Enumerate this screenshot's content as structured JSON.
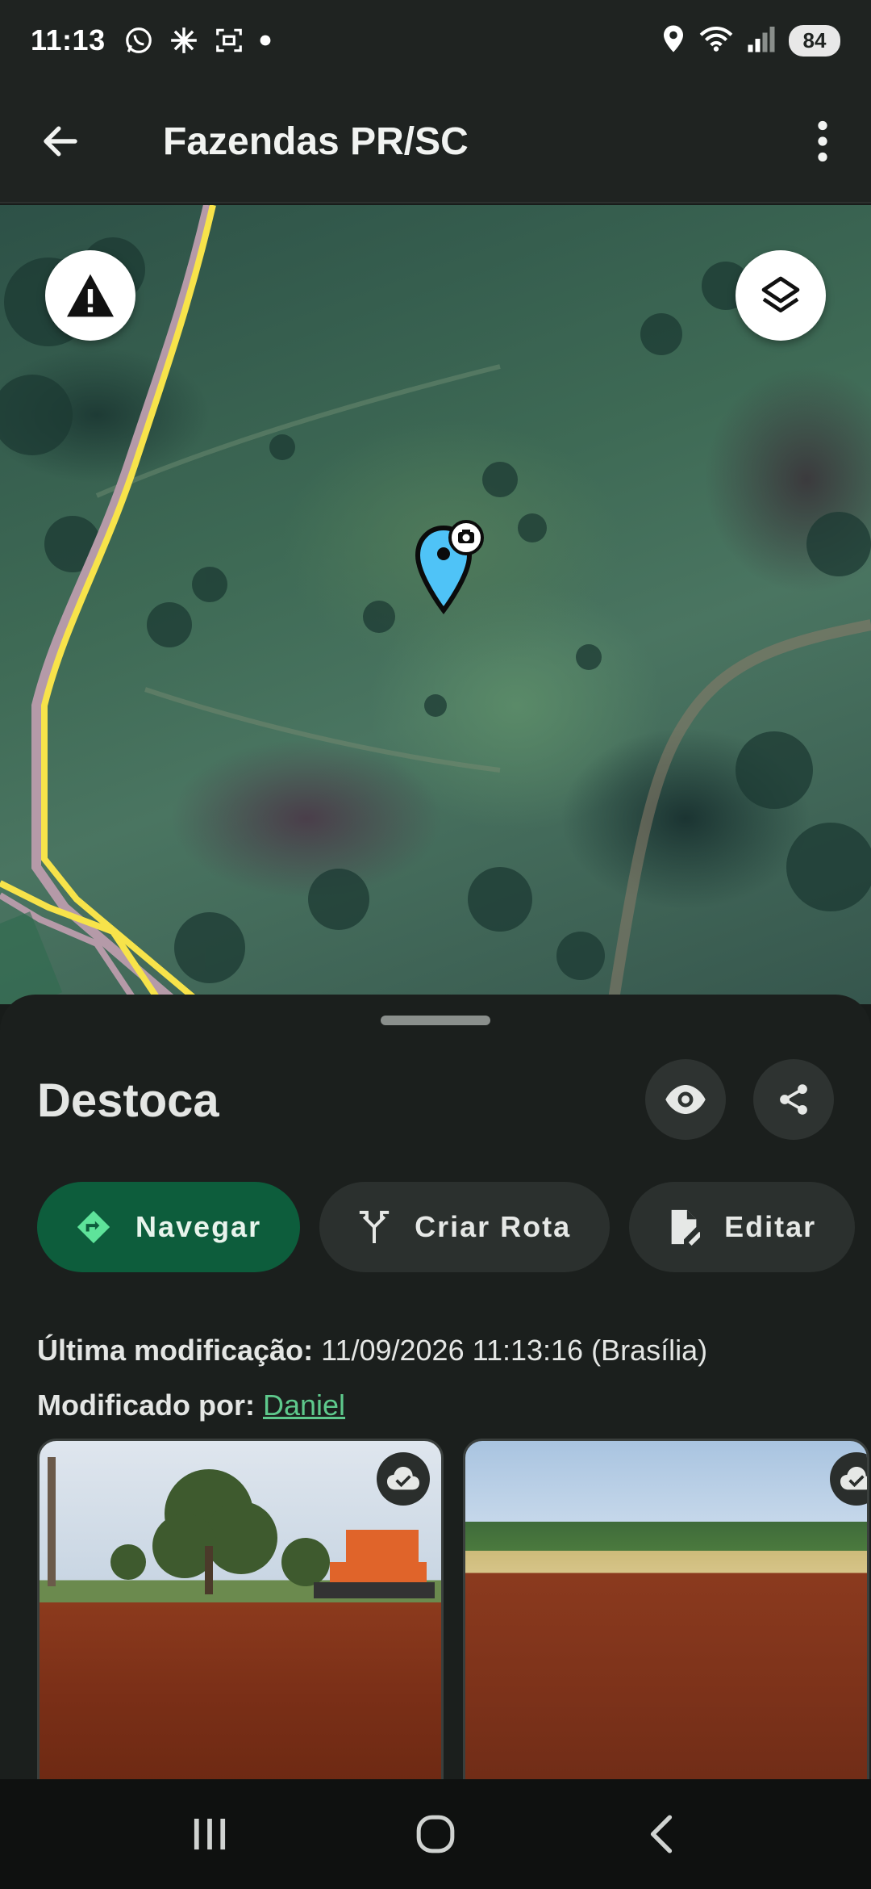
{
  "status_bar": {
    "time": "11:13",
    "battery": "84",
    "left_icons": [
      "whatsapp-icon",
      "sparkle-icon",
      "screenshot-icon",
      "dot-icon"
    ],
    "right_icons": [
      "location-icon",
      "wifi-icon",
      "signal-icon"
    ]
  },
  "app_bar": {
    "title": "Fazendas PR/SC"
  },
  "map": {
    "warning_button": "warning-icon",
    "layers_button": "layers-icon",
    "pin_color": "#4fc3f7"
  },
  "sheet": {
    "title": "Destoca",
    "actions": {
      "navigate": "Navegar",
      "create_route": "Criar Rota",
      "edit": "Editar"
    },
    "last_modified_label": "Última modificação:",
    "last_modified_value": "11/09/2026 11:13:16 (Brasília)",
    "modified_by_label": "Modificado por:",
    "modified_by_value": "Daniel"
  },
  "colors": {
    "primary_chip": "#0d5d3c",
    "link": "#5ec98c",
    "background": "#181c1a"
  }
}
